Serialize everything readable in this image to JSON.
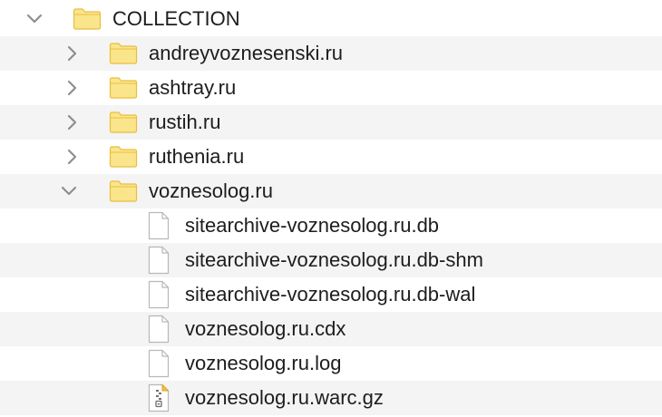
{
  "tree": {
    "root": {
      "label": "COLLECTION",
      "expanded": true
    },
    "folders": [
      {
        "label": "andreyvoznesenski.ru",
        "expanded": false
      },
      {
        "label": "ashtray.ru",
        "expanded": false
      },
      {
        "label": "rustih.ru",
        "expanded": false
      },
      {
        "label": "ruthenia.ru",
        "expanded": false
      },
      {
        "label": "voznesolog.ru",
        "expanded": true
      }
    ],
    "files": [
      {
        "label": "sitearchive-voznesolog.ru.db",
        "icon": "document-icon"
      },
      {
        "label": "sitearchive-voznesolog.ru.db-shm",
        "icon": "document-icon"
      },
      {
        "label": "sitearchive-voznesolog.ru.db-wal",
        "icon": "document-icon"
      },
      {
        "label": "voznesolog.ru.cdx",
        "icon": "document-icon"
      },
      {
        "label": "voznesolog.ru.log",
        "icon": "document-icon"
      },
      {
        "label": "voznesolog.ru.warc.gz",
        "icon": "zip-archive-icon"
      }
    ],
    "colors": {
      "folder_fill": "#fbe58c",
      "folder_stroke": "#e8be3e",
      "alt_row": "#f4f4f5",
      "text": "#1d1d1f"
    }
  }
}
